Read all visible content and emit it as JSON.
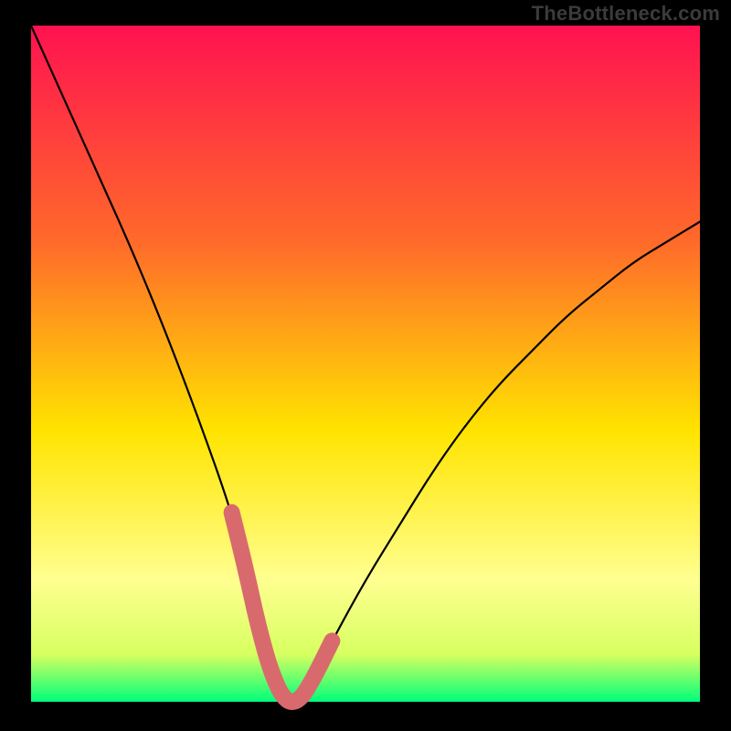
{
  "watermark": "TheBottleneck.com",
  "chart_data": {
    "type": "line",
    "title": "",
    "xlabel": "",
    "ylabel": "",
    "xlim": [
      0,
      100
    ],
    "ylim": [
      0,
      100
    ],
    "grid": false,
    "series": [
      {
        "name": "bottleneck-curve",
        "x": [
          0,
          5,
          10,
          15,
          20,
          25,
          30,
          32,
          34,
          36,
          38,
          40,
          42,
          45,
          50,
          55,
          60,
          65,
          70,
          75,
          80,
          85,
          90,
          95,
          100
        ],
        "values": [
          100,
          89,
          78,
          67,
          55,
          42,
          28,
          20,
          11,
          4,
          0,
          0,
          3,
          9,
          18,
          26,
          34,
          41,
          47,
          52,
          57,
          61,
          65,
          68,
          71
        ]
      }
    ],
    "highlight_segment": {
      "name": "optimal-range",
      "x": [
        30,
        32,
        34,
        36,
        38,
        40,
        42,
        45
      ],
      "values": [
        28,
        20,
        11,
        4,
        0,
        0,
        3,
        9
      ]
    },
    "background_gradient": {
      "top": "#ff1250",
      "mid_upper": "#ff6a2a",
      "mid": "#ffe400",
      "lower": "#ffff90",
      "bottom_band": "#00ff7a"
    }
  }
}
